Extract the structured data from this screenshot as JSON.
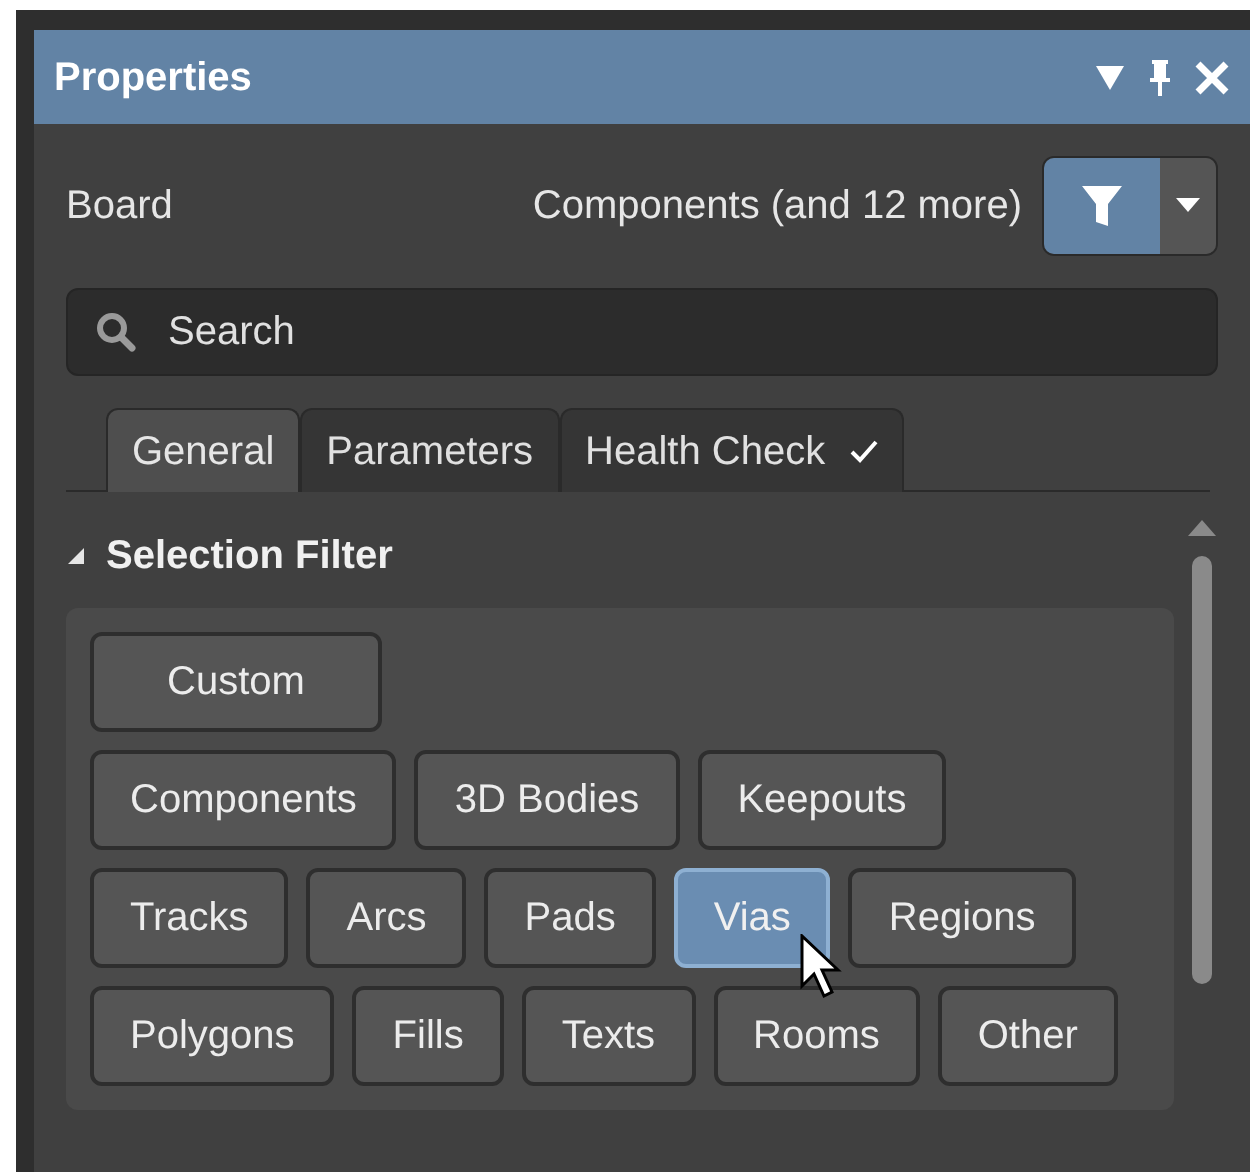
{
  "panel": {
    "title": "Properties"
  },
  "header": {
    "label": "Board",
    "filter_summary": "Components (and 12 more)",
    "filter_active": true
  },
  "search": {
    "placeholder": "Search"
  },
  "tabs": [
    {
      "label": "General",
      "selected": true,
      "checked": false
    },
    {
      "label": "Parameters",
      "selected": false,
      "checked": false
    },
    {
      "label": "Health Check",
      "selected": false,
      "checked": true
    }
  ],
  "section": {
    "title": "Selection Filter",
    "expanded": true
  },
  "filter_rows": [
    [
      {
        "label": "Custom",
        "selected": false
      }
    ],
    [
      {
        "label": "Components",
        "selected": false
      },
      {
        "label": "3D Bodies",
        "selected": false
      },
      {
        "label": "Keepouts",
        "selected": false
      }
    ],
    [
      {
        "label": "Tracks",
        "selected": false
      },
      {
        "label": "Arcs",
        "selected": false
      },
      {
        "label": "Pads",
        "selected": false
      },
      {
        "label": "Vias",
        "selected": true
      },
      {
        "label": "Regions",
        "selected": false
      }
    ],
    [
      {
        "label": "Polygons",
        "selected": false
      },
      {
        "label": "Fills",
        "selected": false
      },
      {
        "label": "Texts",
        "selected": false
      },
      {
        "label": "Rooms",
        "selected": false
      },
      {
        "label": "Other",
        "selected": false
      }
    ]
  ]
}
